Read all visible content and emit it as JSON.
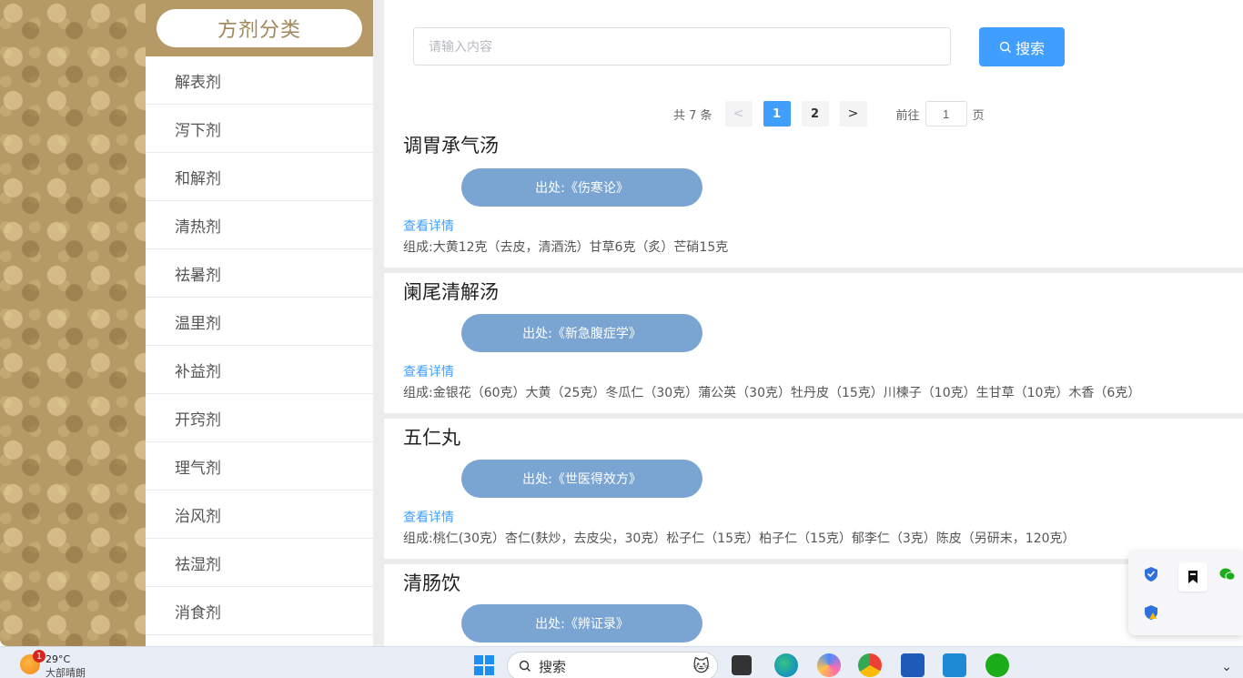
{
  "sidebar": {
    "title": "方剂分类",
    "items": [
      {
        "label": "解表剂"
      },
      {
        "label": "泻下剂"
      },
      {
        "label": "和解剂"
      },
      {
        "label": "清热剂"
      },
      {
        "label": "祛暑剂"
      },
      {
        "label": "温里剂"
      },
      {
        "label": "补益剂"
      },
      {
        "label": "开窍剂"
      },
      {
        "label": "理气剂"
      },
      {
        "label": "治风剂"
      },
      {
        "label": "祛湿剂"
      },
      {
        "label": "消食剂"
      }
    ]
  },
  "search": {
    "placeholder": "请输入内容",
    "button_label": "搜索"
  },
  "pagination": {
    "total": "共 7 条",
    "prev": "<",
    "pages": [
      "1",
      "2"
    ],
    "current": "1",
    "next": ">",
    "goto_label": "前往",
    "goto_value": "1",
    "goto_unit": "页"
  },
  "formulas": [
    {
      "title": "调胃承气汤",
      "source": "出处:《伤寒论》",
      "detail": "查看详情",
      "composition": "组成:大黄12克（去皮，清酒洗）甘草6克（炙）芒硝15克"
    },
    {
      "title": "阑尾清解汤",
      "source": "出处:《新急腹症学》",
      "detail": "查看详情",
      "composition": "组成:金银花（60克）大黄（25克）冬瓜仁（30克）蒲公英（30克）牡丹皮（15克）川楝子（10克）生甘草（10克）木香（6克）"
    },
    {
      "title": "五仁丸",
      "source": "出处:《世医得效方》",
      "detail": "查看详情",
      "composition": "组成:桃仁(30克）杏仁(麸炒，去皮尖，30克）松子仁（15克）柏子仁（15克）郁李仁（3克）陈皮（另研末，120克）"
    },
    {
      "title": "清肠饮",
      "source": "出处:《辨证录》",
      "detail": "",
      "composition": ""
    }
  ],
  "taskbar": {
    "weather_temp": "29°C",
    "weather_desc": "大部晴朗",
    "weather_badge": "1",
    "search_label": "搜索"
  },
  "colors": {
    "accent": "#409eff",
    "sidebar_brand": "#b59a66",
    "pill": "#7aa5d3"
  }
}
